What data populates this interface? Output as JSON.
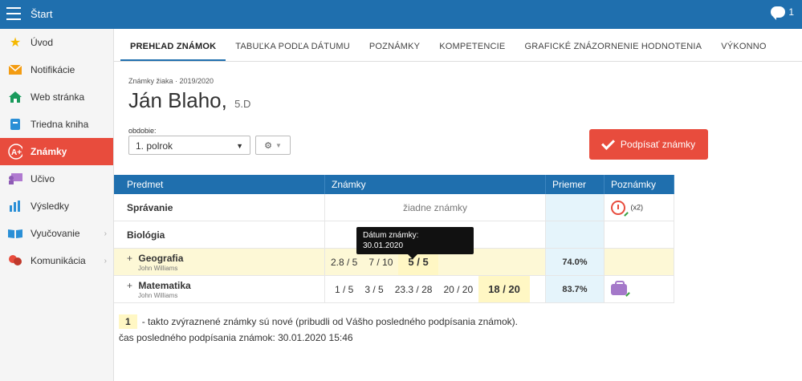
{
  "header": {
    "title": "Štart",
    "chat_count": "1"
  },
  "sidebar": {
    "items": [
      {
        "label": "Úvod",
        "icon": "star-icon"
      },
      {
        "label": "Notifikácie",
        "icon": "envelope-icon"
      },
      {
        "label": "Web stránka",
        "icon": "home-icon"
      },
      {
        "label": "Triedna kniha",
        "icon": "book-icon"
      },
      {
        "label": "Známky",
        "icon": "grade-icon"
      },
      {
        "label": "Učivo",
        "icon": "teacher-icon"
      },
      {
        "label": "Výsledky",
        "icon": "bar-chart-icon"
      },
      {
        "label": "Vyučovanie",
        "icon": "open-book-icon"
      },
      {
        "label": "Komunikácia",
        "icon": "people-icon"
      }
    ]
  },
  "tabs": [
    "PREHĽAD ZNÁMOK",
    "TABUĽKA PODĽA DÁTUMU",
    "POZNÁMKY",
    "KOMPETENCIE",
    "GRAFICKÉ ZNÁZORNENIE HODNOTENIA",
    "VÝKONNO"
  ],
  "student": {
    "meta": "Známky žiaka · 2019/2020",
    "name": "Ján Blaho,",
    "class": "5.D"
  },
  "period": {
    "label": "obdobie:",
    "value": "1. polrok"
  },
  "sign_button": "Podpísať známky",
  "table": {
    "headers": {
      "subject": "Predmet",
      "grades": "Známky",
      "average": "Priemer",
      "notes": "Poznámky"
    },
    "rows": [
      {
        "subject": "Správanie",
        "teacher": "",
        "no_grades": "žiadne známky",
        "grades": [],
        "average": "",
        "note": "(x2)"
      },
      {
        "subject": "Biológia",
        "teacher": "",
        "grades": [],
        "average": ""
      },
      {
        "subject": "Geografia",
        "teacher": "John Williams",
        "grades": [
          "2.8 / 5",
          "7 / 10",
          "5 / 5"
        ],
        "average": "74.0%"
      },
      {
        "subject": "Matematika",
        "teacher": "John Williams",
        "grades": [
          "1 / 5",
          "3 / 5",
          "23.3 / 28",
          "20 / 20",
          "18 / 20"
        ],
        "average": "83.7%"
      }
    ]
  },
  "tooltip": {
    "line1": "Dátum známky:",
    "line2": "30.01.2020"
  },
  "legend": {
    "sample": "1",
    "text": "- takto zvýraznené známky sú nové (pribudli od Vášho posledného podpísania známok)."
  },
  "last_signed": "čas posledného podpísania známok: 30.01.2020 15:46"
}
